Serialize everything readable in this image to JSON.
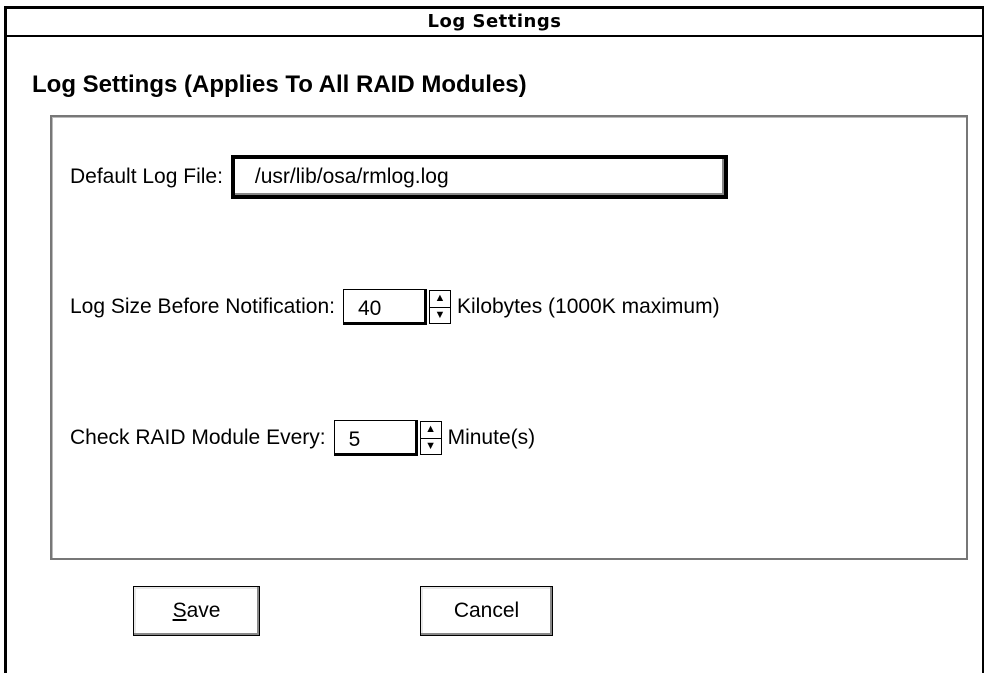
{
  "window": {
    "title": "Log Settings"
  },
  "dialog": {
    "heading": "Log Settings (Applies To All RAID Modules)"
  },
  "fields": {
    "log_file_label": "Default Log File:",
    "log_file_value": "/usr/lib/osa/rmlog.log",
    "log_size_label": "Log Size Before Notification:",
    "log_size_value": "40",
    "log_size_unit": "Kilobytes (1000K maximum)",
    "check_label": "Check RAID Module Every:",
    "check_value": "5",
    "check_unit": "Minute(s)"
  },
  "buttons": {
    "save_mnemonic": "S",
    "save_rest": "ave",
    "cancel": "Cancel"
  },
  "icons": {
    "spin_up": "arrow-up-icon",
    "spin_down": "arrow-down-icon"
  }
}
